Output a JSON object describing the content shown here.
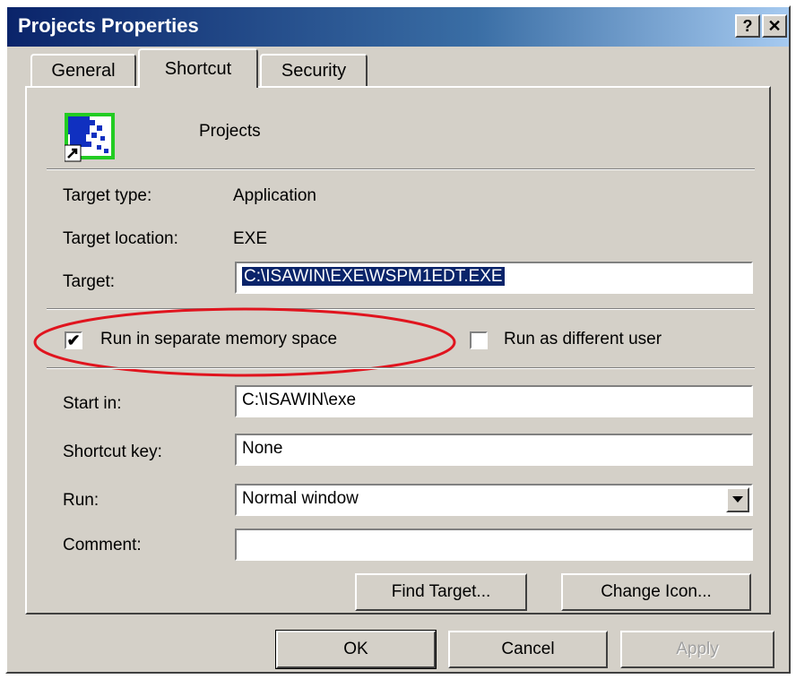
{
  "window": {
    "title": "Projects Properties"
  },
  "title_buttons": {
    "help": "?",
    "close": "✕"
  },
  "tabs": [
    {
      "label": "General",
      "active": false
    },
    {
      "label": "Shortcut",
      "active": true
    },
    {
      "label": "Security",
      "active": false
    }
  ],
  "shortcut": {
    "name": "Projects",
    "icon": "projects-shortcut-icon",
    "target_type_label": "Target type:",
    "target_type_value": "Application",
    "target_location_label": "Target location:",
    "target_location_value": "EXE",
    "target_label": "Target:",
    "target_value": "C:\\ISAWIN\\EXE\\WSPM1EDT.EXE",
    "run_separate_label": "Run in separate memory space",
    "run_separate_checked": true,
    "run_as_label": "Run as different user",
    "run_as_checked": false,
    "start_in_label": "Start in:",
    "start_in_value": "C:\\ISAWIN\\exe",
    "shortcut_key_label": "Shortcut key:",
    "shortcut_key_value": "None",
    "run_label": "Run:",
    "run_value": "Normal window",
    "comment_label": "Comment:",
    "comment_value": "",
    "find_target_label": "Find Target...",
    "change_icon_label": "Change Icon..."
  },
  "footer": {
    "ok": "OK",
    "cancel": "Cancel",
    "apply": "Apply"
  },
  "colors": {
    "titlebar": "#0a246a",
    "face": "#d4d0c8",
    "highlight_ring": "#e0141e",
    "selection": "#0a246a"
  }
}
